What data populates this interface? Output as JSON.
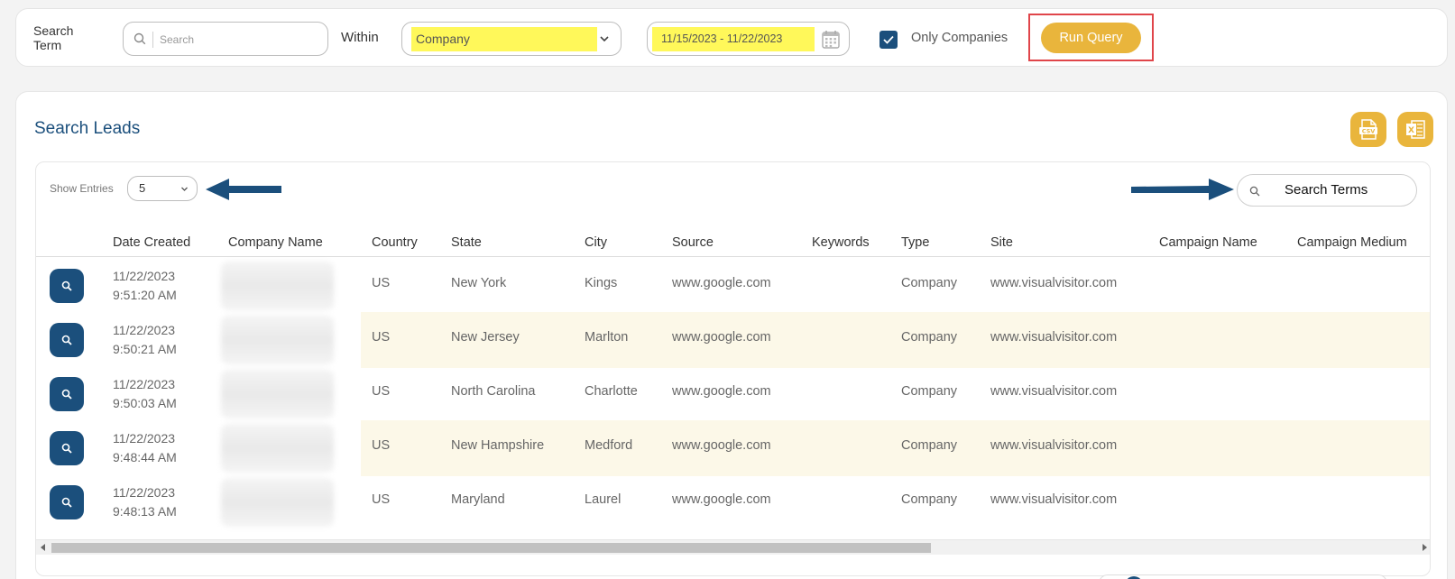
{
  "query_bar": {
    "search_term_label_line1": "Search",
    "search_term_label_line2": "Term",
    "search_placeholder": "Search",
    "within_label": "Within",
    "within_value": "Company",
    "date_range": "11/15/2023 - 11/22/2023",
    "only_companies_label": "Only Companies",
    "only_companies_checked": true,
    "run_query_label": "Run Query"
  },
  "card": {
    "title": "Search Leads",
    "export_csv_icon": "csv-file-icon",
    "export_excel_icon": "excel-file-icon"
  },
  "table_controls": {
    "show_entries_label": "Show Entries",
    "show_entries_value": "5",
    "search_terms_text": "Search Terms"
  },
  "table": {
    "columns": [
      "Date Created",
      "Company Name",
      "Country",
      "State",
      "City",
      "Source",
      "Keywords",
      "Type",
      "Site",
      "Campaign Name",
      "Campaign Medium"
    ],
    "rows": [
      {
        "date": "11/22/2023",
        "time": "9:51:20 AM",
        "country": "US",
        "state": "New York",
        "city": "Kings",
        "source": "www.google.com",
        "keywords": "",
        "type": "Company",
        "site": "www.visualvisitor.com",
        "campaign_name": "",
        "campaign_medium": ""
      },
      {
        "date": "11/22/2023",
        "time": "9:50:21 AM",
        "country": "US",
        "state": "New Jersey",
        "city": "Marlton",
        "source": "www.google.com",
        "keywords": "",
        "type": "Company",
        "site": "www.visualvisitor.com",
        "campaign_name": "",
        "campaign_medium": ""
      },
      {
        "date": "11/22/2023",
        "time": "9:50:03 AM",
        "country": "US",
        "state": "North Carolina",
        "city": "Charlotte",
        "source": "www.google.com",
        "keywords": "",
        "type": "Company",
        "site": "www.visualvisitor.com",
        "campaign_name": "",
        "campaign_medium": ""
      },
      {
        "date": "11/22/2023",
        "time": "9:48:44 AM",
        "country": "US",
        "state": "New Hampshire",
        "city": "Medford",
        "source": "www.google.com",
        "keywords": "",
        "type": "Company",
        "site": "www.visualvisitor.com",
        "campaign_name": "",
        "campaign_medium": ""
      },
      {
        "date": "11/22/2023",
        "time": "9:48:13 AM",
        "country": "US",
        "state": "Maryland",
        "city": "Laurel",
        "source": "www.google.com",
        "keywords": "",
        "type": "Company",
        "site": "www.visualvisitor.com",
        "campaign_name": "",
        "campaign_medium": ""
      }
    ]
  },
  "colors": {
    "brand_blue": "#1b4f7c",
    "accent_gold": "#e9b53c",
    "highlight_yellow": "#fff85a",
    "annotation_red": "#e0454a",
    "row_stripe": "#fcf8e8"
  }
}
